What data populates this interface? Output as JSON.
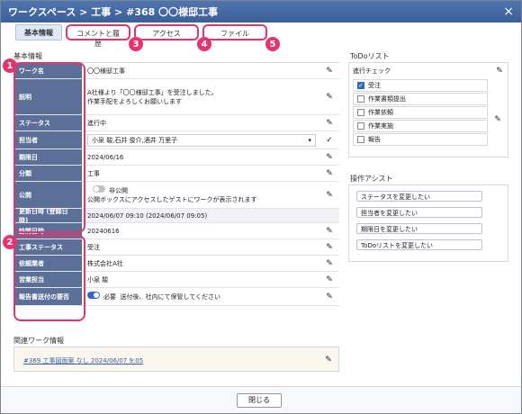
{
  "window": {
    "title": "ワークスペース > 工事 > #368 〇〇様邸工事",
    "close": "×"
  },
  "tabs": [
    {
      "label": "基本情報"
    },
    {
      "label": "コメントと履歴"
    },
    {
      "label": "アクセス"
    },
    {
      "label": "ファイル"
    }
  ],
  "badges": [
    "1",
    "2",
    "3",
    "4",
    "5"
  ],
  "basic": {
    "heading": "基本情報",
    "rows": [
      {
        "label": "ワーク名",
        "value": "〇〇様邸工事"
      },
      {
        "label": "説明",
        "value1": "A社様より「〇〇様邸工事」を受注しました。",
        "value2": "作業手配をよろしくお願いします"
      },
      {
        "label": "ステータス",
        "value": "進行中"
      },
      {
        "label": "担当者",
        "value": "小泉 駿,石井 俊介,酒井 万里子"
      },
      {
        "label": "期限日",
        "value": "2024/06/16"
      },
      {
        "label": "分類",
        "value": "工事"
      },
      {
        "label": "公開",
        "value1": "非公開",
        "value2": "公開ボックスにアクセスしたゲストにワークが表示されます"
      },
      {
        "label": "更新日時 (登録日時)",
        "value": "2024/06/07 09:10 (2024/06/07 09:05)"
      }
    ],
    "custom_rows": [
      {
        "label": "訪問日時",
        "value": "20240616"
      },
      {
        "label": "工事ステータス",
        "value": "受注"
      },
      {
        "label": "依頼業者",
        "value": "株式会社A社"
      },
      {
        "label": "営業担当",
        "value": "小泉 駿"
      },
      {
        "label": "報告書送付の要否",
        "toggle": "必要",
        "value": "送付後、社内にて保管してください"
      }
    ]
  },
  "related": {
    "heading": "関連ワーク情報",
    "link": "#369 工事図面案 なし 2024/06/07 9:05"
  },
  "todo": {
    "heading": "ToDoリスト",
    "group": "進行チェック",
    "items": [
      {
        "label": "受注",
        "checked": true
      },
      {
        "label": "作業書類提出",
        "checked": false
      },
      {
        "label": "作業依頼",
        "checked": false
      },
      {
        "label": "作業実施",
        "checked": false
      },
      {
        "label": "報告",
        "checked": false
      }
    ]
  },
  "assist": {
    "heading": "操作アシスト",
    "buttons": [
      "ステータスを変更したい",
      "担当者を変更したい",
      "期限日を変更したい",
      "ToDoリストを変更したい"
    ]
  },
  "footer": {
    "close_label": "閉じる"
  },
  "colors": {
    "accent": "#e6336e",
    "label_bg": "#5b6f98",
    "titlebar": "#3b5f99"
  }
}
